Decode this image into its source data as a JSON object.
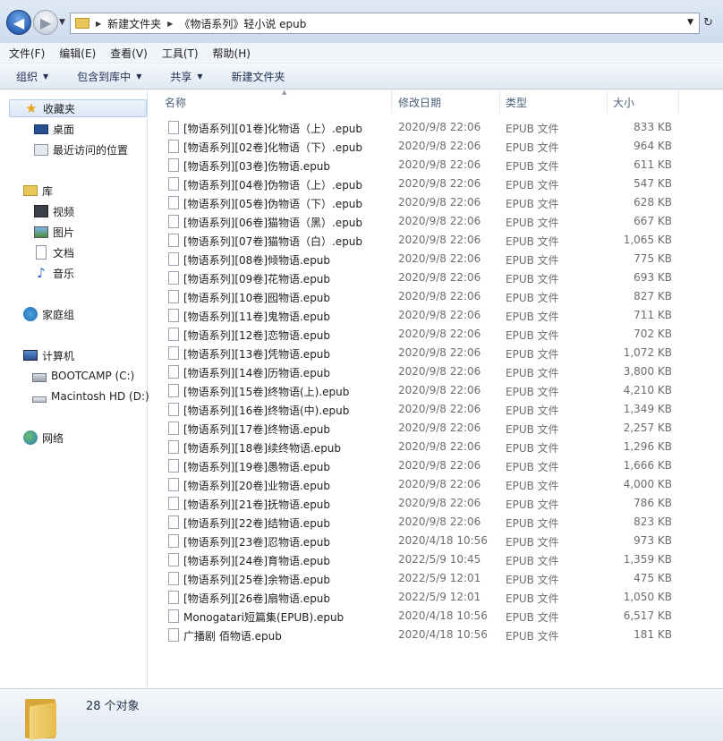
{
  "address": {
    "crumbs": [
      "新建文件夹",
      "《物语系列》轻小说 epub"
    ]
  },
  "menu": [
    "文件(F)",
    "编辑(E)",
    "查看(V)",
    "工具(T)",
    "帮助(H)"
  ],
  "toolbar": [
    {
      "label": "组织",
      "caret": true
    },
    {
      "label": "包含到库中",
      "caret": true
    },
    {
      "label": "共享",
      "caret": true
    },
    {
      "label": "新建文件夹",
      "caret": false
    }
  ],
  "nav": {
    "favorites": {
      "label": "收藏夹",
      "items": [
        "桌面",
        "最近访问的位置"
      ]
    },
    "libraries": {
      "label": "库",
      "items": [
        "视频",
        "图片",
        "文档",
        "音乐"
      ]
    },
    "homegroup": "家庭组",
    "computer": {
      "label": "计算机",
      "items": [
        "BOOTCAMP (C:)",
        "Macintosh HD (D:)"
      ]
    },
    "network": "网络"
  },
  "columns": {
    "name": "名称",
    "date": "修改日期",
    "type": "类型",
    "size": "大小"
  },
  "files": [
    {
      "name": "[物语系列][01卷]化物语（上）.epub",
      "date": "2020/9/8 22:06",
      "type": "EPUB 文件",
      "size": "833 KB"
    },
    {
      "name": "[物语系列][02卷]化物语（下）.epub",
      "date": "2020/9/8 22:06",
      "type": "EPUB 文件",
      "size": "964 KB"
    },
    {
      "name": "[物语系列][03卷]伤物语.epub",
      "date": "2020/9/8 22:06",
      "type": "EPUB 文件",
      "size": "611 KB"
    },
    {
      "name": "[物语系列][04卷]伪物语（上）.epub",
      "date": "2020/9/8 22:06",
      "type": "EPUB 文件",
      "size": "547 KB"
    },
    {
      "name": "[物语系列][05卷]伪物语（下）.epub",
      "date": "2020/9/8 22:06",
      "type": "EPUB 文件",
      "size": "628 KB"
    },
    {
      "name": "[物语系列][06卷]猫物语（黑）.epub",
      "date": "2020/9/8 22:06",
      "type": "EPUB 文件",
      "size": "667 KB"
    },
    {
      "name": "[物语系列][07卷]猫物语（白）.epub",
      "date": "2020/9/8 22:06",
      "type": "EPUB 文件",
      "size": "1,065 KB"
    },
    {
      "name": "[物语系列][08卷]倾物语.epub",
      "date": "2020/9/8 22:06",
      "type": "EPUB 文件",
      "size": "775 KB"
    },
    {
      "name": "[物语系列][09卷]花物语.epub",
      "date": "2020/9/8 22:06",
      "type": "EPUB 文件",
      "size": "693 KB"
    },
    {
      "name": "[物语系列][10卷]囮物语.epub",
      "date": "2020/9/8 22:06",
      "type": "EPUB 文件",
      "size": "827 KB"
    },
    {
      "name": "[物语系列][11卷]鬼物语.epub",
      "date": "2020/9/8 22:06",
      "type": "EPUB 文件",
      "size": "711 KB"
    },
    {
      "name": "[物语系列][12卷]恋物语.epub",
      "date": "2020/9/8 22:06",
      "type": "EPUB 文件",
      "size": "702 KB"
    },
    {
      "name": "[物语系列][13卷]凭物语.epub",
      "date": "2020/9/8 22:06",
      "type": "EPUB 文件",
      "size": "1,072 KB"
    },
    {
      "name": "[物语系列][14卷]历物语.epub",
      "date": "2020/9/8 22:06",
      "type": "EPUB 文件",
      "size": "3,800 KB"
    },
    {
      "name": "[物语系列][15卷]终物语(上).epub",
      "date": "2020/9/8 22:06",
      "type": "EPUB 文件",
      "size": "4,210 KB"
    },
    {
      "name": "[物语系列][16卷]终物语(中).epub",
      "date": "2020/9/8 22:06",
      "type": "EPUB 文件",
      "size": "1,349 KB"
    },
    {
      "name": "[物语系列][17卷]终物语.epub",
      "date": "2020/9/8 22:06",
      "type": "EPUB 文件",
      "size": "2,257 KB"
    },
    {
      "name": "[物语系列][18卷]续终物语.epub",
      "date": "2020/9/8 22:06",
      "type": "EPUB 文件",
      "size": "1,296 KB"
    },
    {
      "name": "[物语系列][19卷]愚物语.epub",
      "date": "2020/9/8 22:06",
      "type": "EPUB 文件",
      "size": "1,666 KB"
    },
    {
      "name": "[物语系列][20卷]业物语.epub",
      "date": "2020/9/8 22:06",
      "type": "EPUB 文件",
      "size": "4,000 KB"
    },
    {
      "name": "[物语系列][21卷]抚物语.epub",
      "date": "2020/9/8 22:06",
      "type": "EPUB 文件",
      "size": "786 KB"
    },
    {
      "name": "[物语系列][22卷]结物语.epub",
      "date": "2020/9/8 22:06",
      "type": "EPUB 文件",
      "size": "823 KB"
    },
    {
      "name": "[物语系列][23卷]忍物语.epub",
      "date": "2020/4/18 10:56",
      "type": "EPUB 文件",
      "size": "973 KB"
    },
    {
      "name": "[物语系列][24卷]育物语.epub",
      "date": "2022/5/9 10:45",
      "type": "EPUB 文件",
      "size": "1,359 KB"
    },
    {
      "name": "[物语系列][25卷]余物语.epub",
      "date": "2022/5/9 12:01",
      "type": "EPUB 文件",
      "size": "475 KB"
    },
    {
      "name": "[物语系列][26卷]扇物语.epub",
      "date": "2022/5/9 12:01",
      "type": "EPUB 文件",
      "size": "1,050 KB"
    },
    {
      "name": "Monogatari短篇集(EPUB).epub",
      "date": "2020/4/18 10:56",
      "type": "EPUB 文件",
      "size": "6,517 KB"
    },
    {
      "name": "广播剧 佰物语.epub",
      "date": "2020/4/18 10:56",
      "type": "EPUB 文件",
      "size": "181 KB"
    }
  ],
  "status": {
    "count": "28 个对象"
  }
}
